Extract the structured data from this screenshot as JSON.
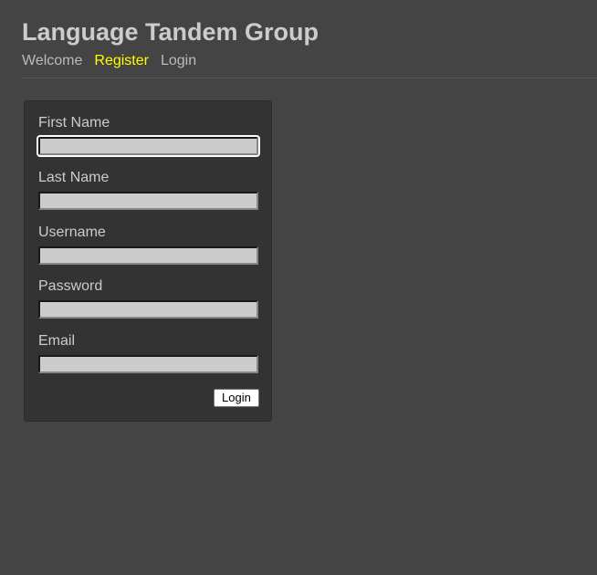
{
  "header": {
    "title": "Language Tandem Group"
  },
  "nav": {
    "items": [
      {
        "label": "Welcome"
      },
      {
        "label": "Register"
      },
      {
        "label": "Login"
      }
    ]
  },
  "colors": {
    "background": "#444444",
    "panel": "#333333",
    "active_link": "#ffff00",
    "link": "#bbbbbb"
  },
  "form": {
    "fields": [
      {
        "label": "First Name",
        "value": ""
      },
      {
        "label": "Last Name",
        "value": ""
      },
      {
        "label": "Username",
        "value": ""
      },
      {
        "label": "Password",
        "value": ""
      },
      {
        "label": "Email",
        "value": ""
      }
    ],
    "submit_label": "Login"
  }
}
